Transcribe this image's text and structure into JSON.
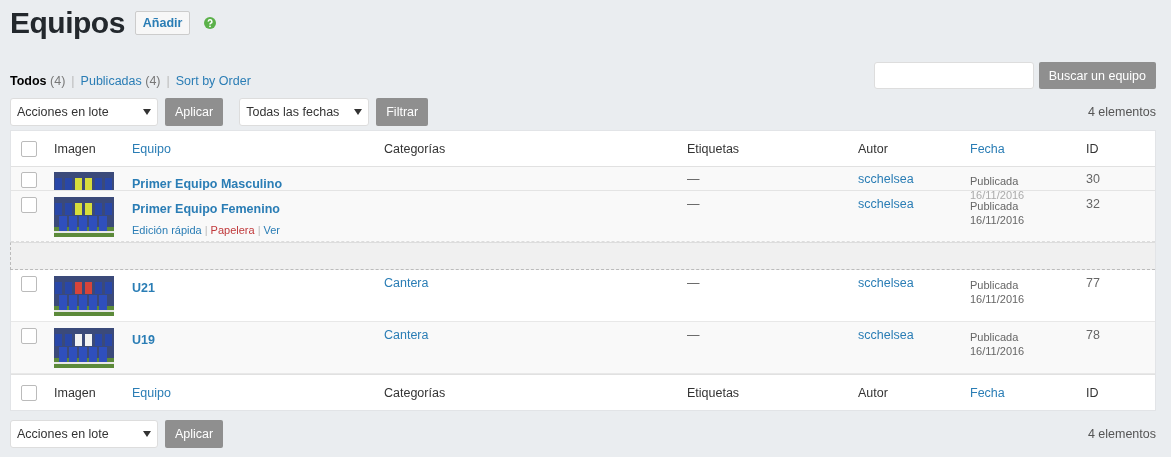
{
  "title": "Equipos",
  "add_button": "Añadir",
  "views": [
    {
      "label": "Todos",
      "count": "(4)",
      "selected": true
    },
    {
      "separator": "|",
      "label": "Publicadas",
      "count": "(4)",
      "selected": false
    },
    {
      "separator": "|",
      "label": "Sort by Order",
      "selected": false
    }
  ],
  "search": {
    "button": "Buscar un equipo"
  },
  "top_actions": {
    "bulk": "Acciones en lote",
    "apply": "Aplicar",
    "dates": "Todas las fechas",
    "filter": "Filtrar",
    "count": "4 elementos"
  },
  "header": {
    "select_all_checked": false,
    "columns": [
      {
        "label": "Imagen",
        "sortable": false
      },
      {
        "label": "Equipo",
        "sortable": true
      },
      {
        "label": "Categorías",
        "sortable": false
      },
      {
        "label": "Etiquetas",
        "sortable": false
      },
      {
        "label": "Autor",
        "sortable": false
      },
      {
        "label": "Fecha",
        "sortable": true
      },
      {
        "label": "ID",
        "sortable": false
      }
    ]
  },
  "rows": [
    {
      "kind": "covered",
      "checked": false,
      "title": "Primer Equipo Masculino",
      "category": "",
      "tags": "—",
      "author": "scchelsea",
      "status": "Publicada",
      "date": "16/11/2016",
      "id": "30"
    },
    {
      "kind": "dragging",
      "checked": false,
      "title": "Primer Equipo Femenino",
      "category": "",
      "tags": "—",
      "author": "scchelsea",
      "status": "Publicada",
      "date": "16/11/2016",
      "id": "32",
      "actions": [
        {
          "label": "Edición rápida",
          "danger": false
        },
        {
          "separator": "|",
          "label": "Papelera",
          "danger": true
        },
        {
          "separator": "|",
          "label": "Ver",
          "danger": false
        }
      ]
    },
    {
      "kind": "placeholder"
    },
    {
      "kind": "row",
      "checked": false,
      "title": "U21",
      "category": "Cantera",
      "tags": "—",
      "author": "scchelsea",
      "status": "Publicada",
      "date": "16/11/2016",
      "id": "77"
    },
    {
      "kind": "row",
      "checked": false,
      "title": "U19",
      "category": "Cantera",
      "tags": "—",
      "author": "scchelsea",
      "status": "Publicada",
      "date": "16/11/2016",
      "id": "78"
    }
  ],
  "footer": {
    "select_all_checked": false,
    "columns": [
      {
        "label": "Imagen",
        "sortable": false
      },
      {
        "label": "Equipo",
        "sortable": true
      },
      {
        "label": "Categorías",
        "sortable": false
      },
      {
        "label": "Etiquetas",
        "sortable": false
      },
      {
        "label": "Autor",
        "sortable": false
      },
      {
        "label": "Fecha",
        "sortable": true
      },
      {
        "label": "ID",
        "sortable": false
      }
    ]
  },
  "bottom_actions": {
    "bulk": "Acciones en lote",
    "apply": "Aplicar",
    "count": "4 elementos"
  }
}
